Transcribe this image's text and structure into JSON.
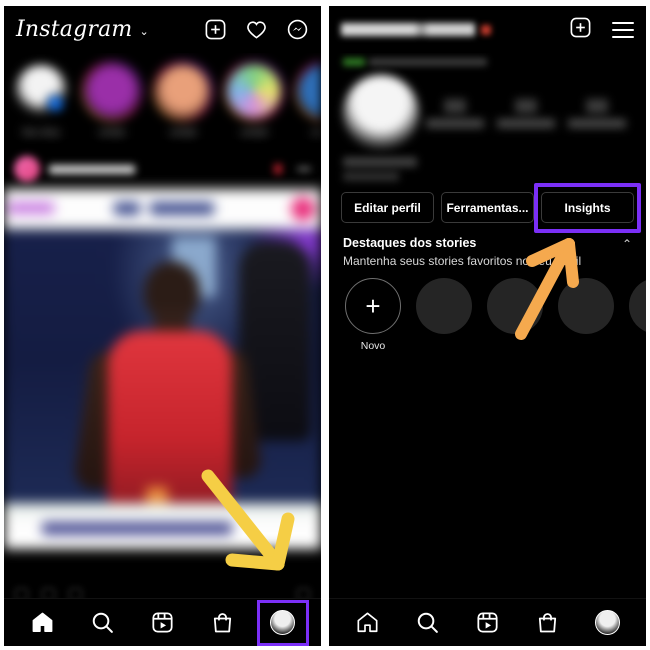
{
  "left_panel": {
    "name": "instagram-feed-screen",
    "header": {
      "logo_text": "Instagram",
      "chevron": "⌄",
      "icons": [
        "add-post-icon",
        "activity-heart-icon",
        "messenger-icon"
      ]
    },
    "stories": {
      "items": [
        {
          "label": "Seu story"
        },
        {
          "label": "conta1"
        },
        {
          "label": "conta2"
        },
        {
          "label": "conta3"
        },
        {
          "label": "conta4"
        }
      ]
    },
    "post": {
      "author": "",
      "media_description": "blurred photo of a football player in a red jersey"
    },
    "bottom_nav": {
      "items": [
        {
          "name": "home",
          "icon": "home-filled-icon",
          "highlighted": false
        },
        {
          "name": "search",
          "icon": "search-icon",
          "highlighted": false
        },
        {
          "name": "reels",
          "icon": "reels-icon",
          "highlighted": false
        },
        {
          "name": "shop",
          "icon": "shop-bag-icon",
          "highlighted": false
        },
        {
          "name": "profile",
          "icon": "profile-avatar-icon",
          "highlighted": true
        }
      ]
    },
    "annotation": {
      "arrow": "yellow-arrow-pointing-to-profile-tab",
      "color": "#F5CE45"
    }
  },
  "right_panel": {
    "name": "instagram-profile-screen",
    "header": {
      "username": "",
      "icons": [
        "add-post-icon",
        "hamburger-menu-icon"
      ]
    },
    "profile": {
      "avatar": "profile-avatar",
      "stats": [
        {
          "value": "",
          "label": ""
        },
        {
          "value": "",
          "label": ""
        },
        {
          "value": "",
          "label": ""
        }
      ],
      "bio": ""
    },
    "action_buttons": [
      {
        "label": "Editar perfil",
        "highlighted": false
      },
      {
        "label": "Ferramentas...",
        "highlighted": false
      },
      {
        "label": "Insights",
        "highlighted": true
      }
    ],
    "highlights": {
      "title": "Destaques dos stories",
      "subtitle": "Mantenha seus stories favoritos no seu perfil",
      "collapse_chevron": "⌃",
      "items": [
        {
          "label": "Novo",
          "is_new": true
        },
        {
          "label": "",
          "is_new": false
        },
        {
          "label": "",
          "is_new": false
        },
        {
          "label": "",
          "is_new": false
        },
        {
          "label": "",
          "is_new": false
        }
      ]
    },
    "bottom_nav": {
      "items": [
        {
          "name": "home",
          "icon": "home-outline-icon",
          "highlighted": false
        },
        {
          "name": "search",
          "icon": "search-icon",
          "highlighted": false
        },
        {
          "name": "reels",
          "icon": "reels-icon",
          "highlighted": false
        },
        {
          "name": "shop",
          "icon": "shop-bag-icon",
          "highlighted": false
        },
        {
          "name": "profile",
          "icon": "profile-avatar-icon",
          "highlighted": false
        }
      ]
    },
    "annotation": {
      "arrow": "orange-arrow-pointing-to-insights-button",
      "color": "#F5A94E"
    }
  },
  "colors": {
    "highlight_purple": "#7B2FF7",
    "arrow_yellow": "#F5CE45",
    "arrow_orange": "#F5A94E",
    "background": "#000000",
    "page_background": "#FFFFFF"
  }
}
